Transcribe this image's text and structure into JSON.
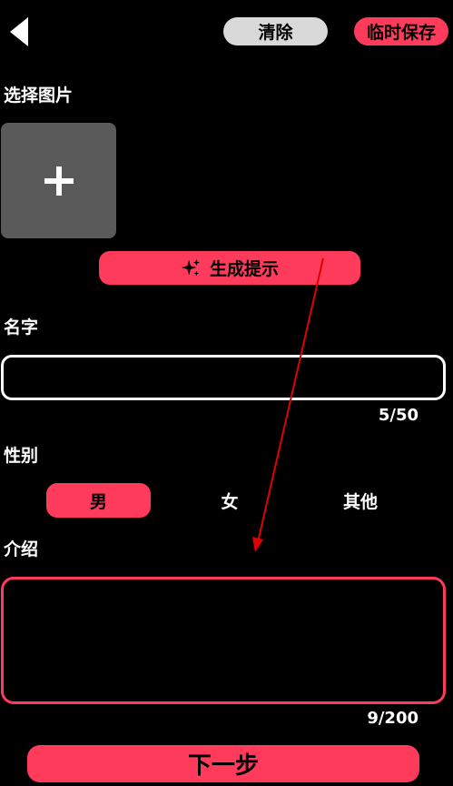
{
  "toolbar": {
    "clear_label": "清除",
    "save_label": "临时保存"
  },
  "image_section": {
    "label": "选择图片"
  },
  "generate_hint": {
    "label": "生成提示"
  },
  "name_section": {
    "label": "名字",
    "value": "",
    "counter": "5/50"
  },
  "gender_section": {
    "label": "性别",
    "options": [
      "男",
      "女",
      "其他"
    ],
    "selected": "男"
  },
  "intro_section": {
    "label": "介绍",
    "value": "",
    "counter": "9/200"
  },
  "next": {
    "label": "下一步"
  },
  "colors": {
    "accent": "#ff3b5c",
    "background": "#000000",
    "clear_button": "#d9d9d9",
    "image_tile": "#5a5a5a",
    "annotation_arrow": "#e00000"
  },
  "icons": {
    "back": "back-arrow-icon",
    "add": "plus-icon",
    "sparkle": "sparkle-icon"
  }
}
